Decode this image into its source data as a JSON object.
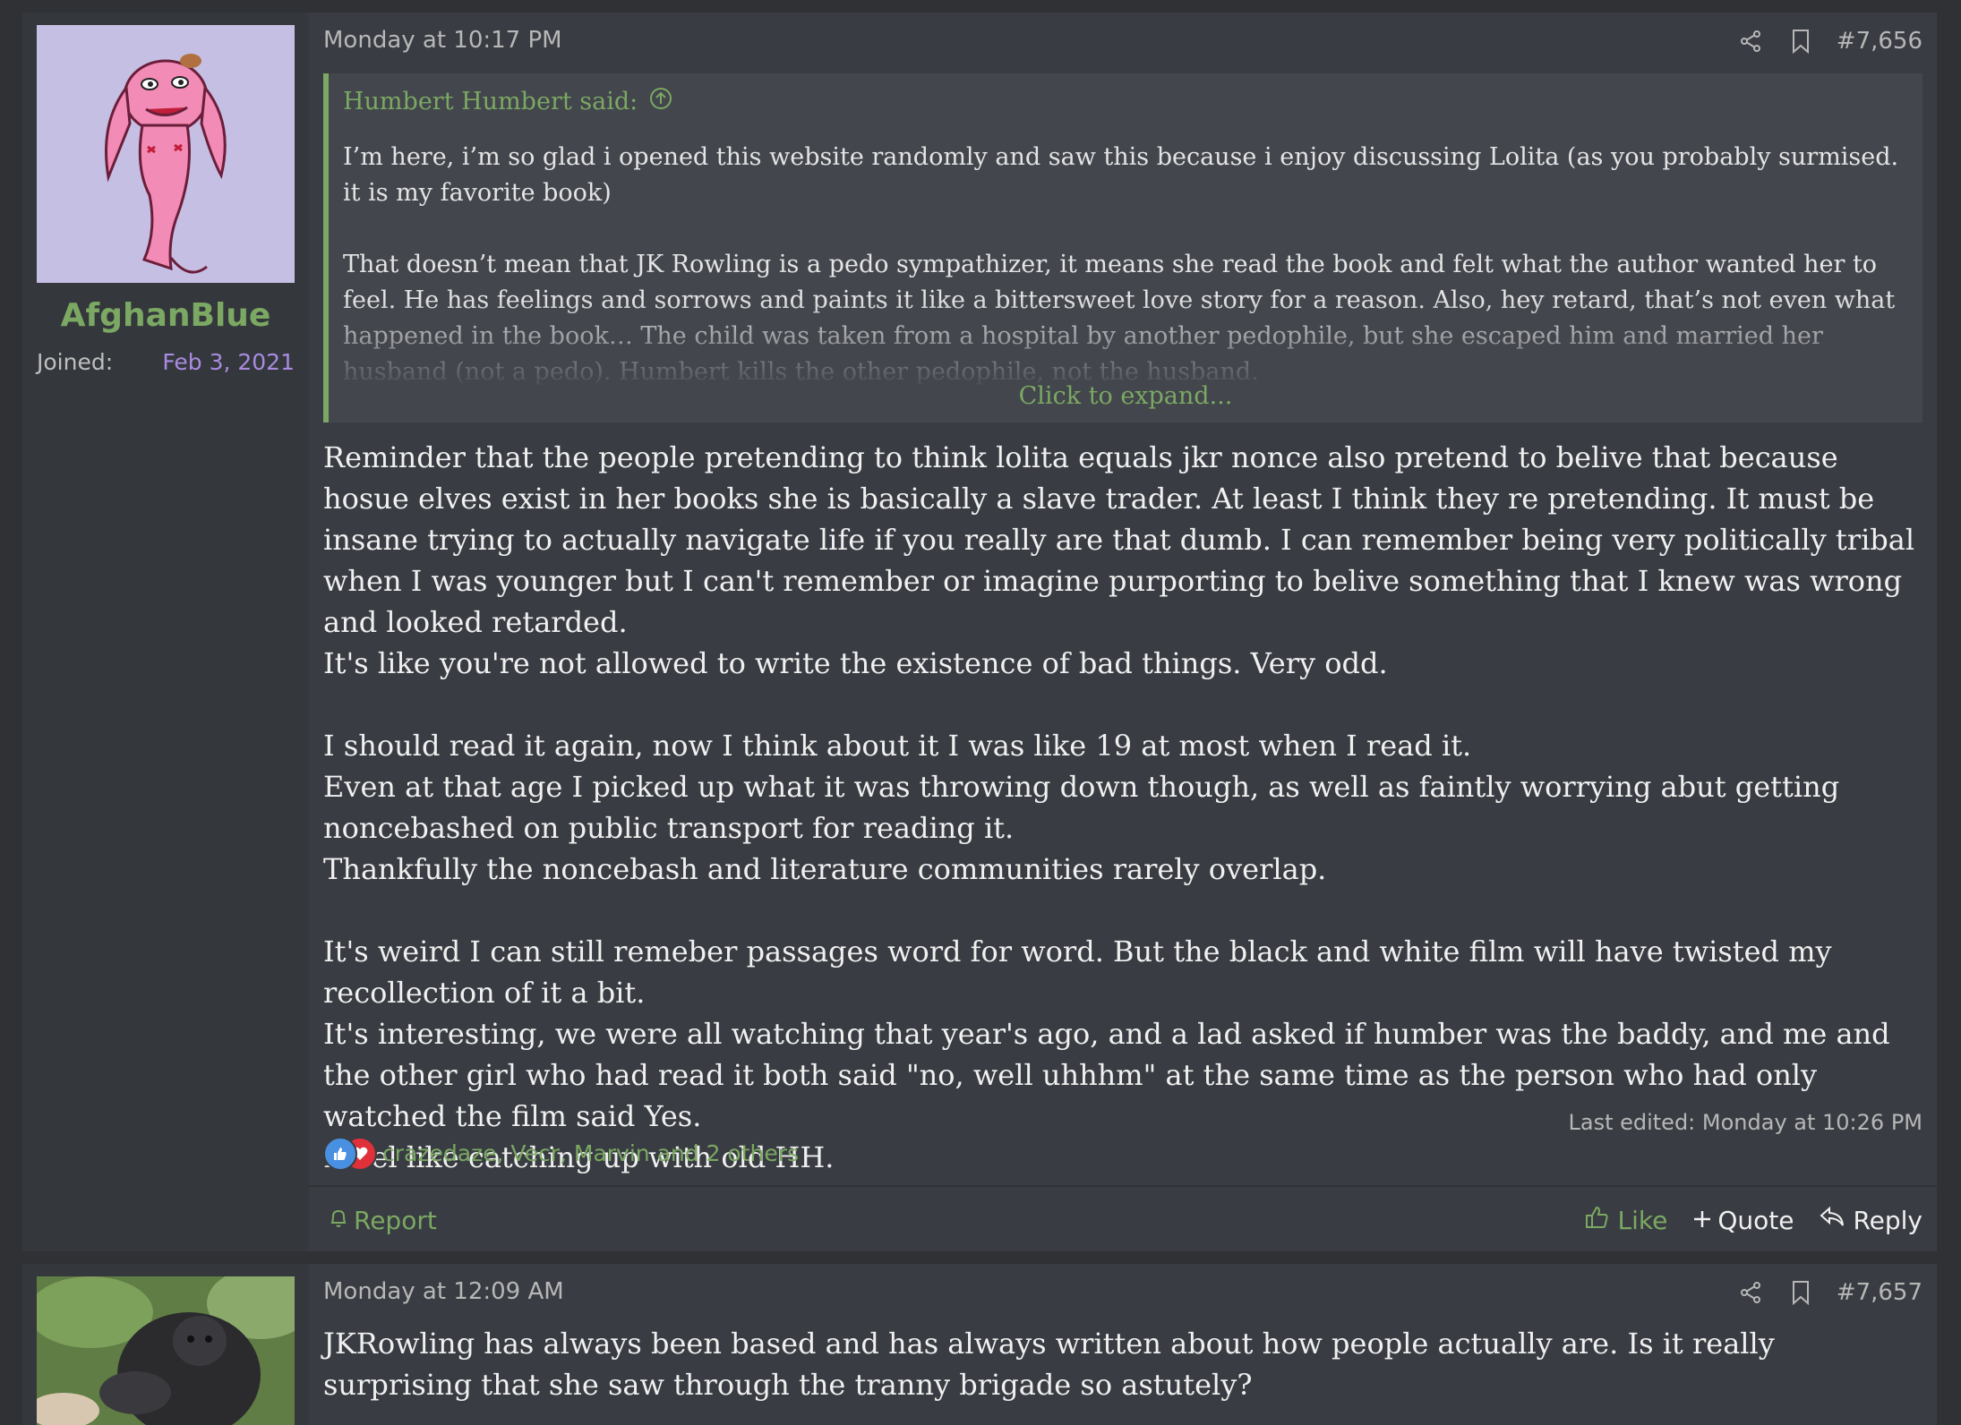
{
  "posts": [
    {
      "author": "AfghanBlue",
      "joined_label": "Joined:",
      "joined_date": "Feb 3, 2021",
      "date": "Monday at 10:17 PM",
      "post_number": "#7,656",
      "quote": {
        "author_said": "Humbert Humbert said:",
        "paragraphs": [
          "I’m here, i’m so glad i opened this website randomly and saw this because i enjoy discussing Lolita (as you probably surmised. it is my favorite book)",
          "That doesn’t mean that JK Rowling is a pedo sympathizer, it means she read the book and felt what the author wanted her to feel. He has feelings and sorrows and paints it like a bittersweet love story for a reason. Also, hey retard, that’s not even what happened in the book… The child was taken from a hospital by another pedophile, but she escaped him and married her husband (not a pedo). Humbert kills the other pedophile, not the husband."
        ],
        "expand_label": "Click to expand..."
      },
      "message": {
        "block1": [
          "Reminder that the people pretending to think lolita equals jkr nonce also pretend to belive that because hosue elves exist in her books she is basically a slave trader. At least I think they re pretending. It must be insane trying to actually navigate life if you really are that dumb. I can remember being very politically tribal when I was younger but I can't remember or imagine purporting to belive something that I knew was wrong and looked retarded.",
          "It's like you're not allowed to write the existence of bad things. Very odd."
        ],
        "block2": [
          "I should read it again, now I think about it I was like 19 at most when I read it.",
          "Even at that age I picked up what it was throwing down though, as well as faintly worrying abut getting noncebashed on public transport for reading it.",
          "Thankfully the noncebash and literature communities rarely overlap."
        ],
        "block3": [
          "It's weird I can still remeber passages word for word. But the black and white film will have twisted my recollection of it a bit.",
          "It's interesting, we were all watching that year's ago, and a lad asked if humber was the baddy, and me and the other girl who had read it both said \"no, well uhhhm\" at the same time as the person who had only watched the film said Yes.",
          "I feel like catching up with old HH."
        ]
      },
      "last_edited": "Last edited: Monday at 10:26 PM",
      "reactions_text": "crazedaze, Vecr, Marvin and 2 others",
      "report_label": "Report",
      "like_label": "Like",
      "quote_label": "Quote",
      "reply_label": "Reply"
    },
    {
      "date": "Monday at 12:09 AM",
      "post_number": "#7,657",
      "message": "JKRowling has always been based and has always written about how people actually are. Is it really surprising that she saw through the tranny brigade so astutely?"
    }
  ],
  "colors": {
    "accent_green": "#7ba862",
    "joined_purple": "#a98be0",
    "page_bg": "#2f3135",
    "post_bg": "#393c42"
  }
}
